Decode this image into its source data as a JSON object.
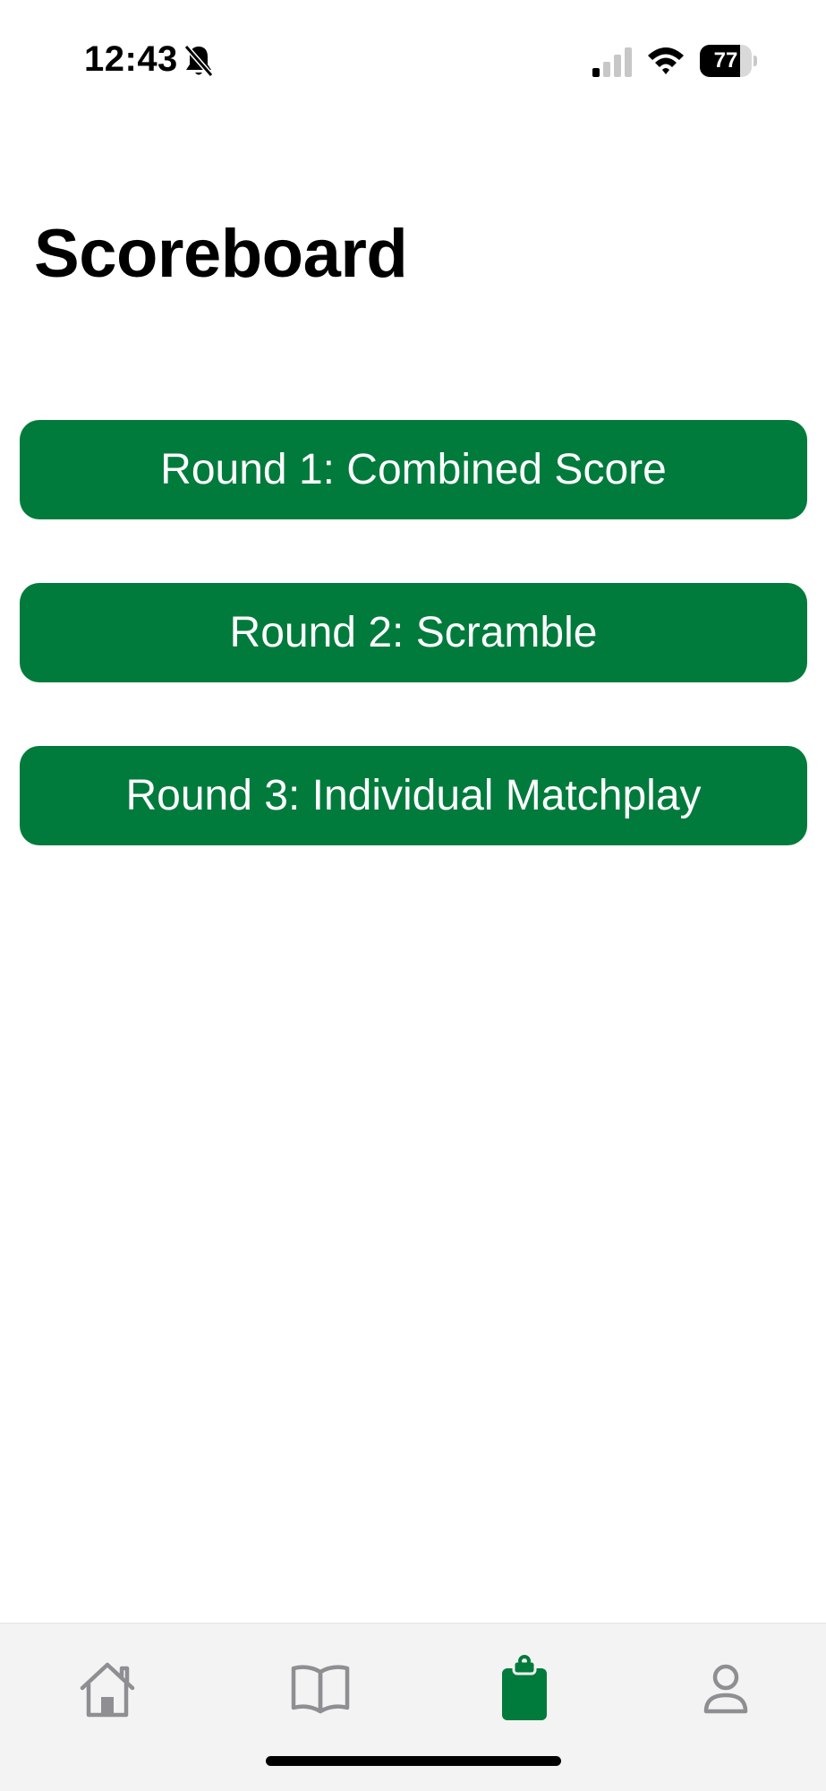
{
  "status_bar": {
    "time": "12:43",
    "battery_level": "77",
    "battery_fraction": 0.77,
    "signal_bars_active": 1,
    "signal_bars_total": 4,
    "icons": [
      "bell-slash-icon",
      "cellular-signal-icon",
      "wifi-icon",
      "battery-icon"
    ]
  },
  "header": {
    "title": "Scoreboard"
  },
  "rounds": [
    {
      "label": "Round 1: Combined Score"
    },
    {
      "label": "Round 2: Scramble"
    },
    {
      "label": "Round 3: Individual Matchplay"
    }
  ],
  "tab_bar": {
    "tabs": [
      {
        "icon": "home-icon",
        "active": false
      },
      {
        "icon": "book-icon",
        "active": false
      },
      {
        "icon": "clipboard-icon",
        "active": true
      },
      {
        "icon": "person-icon",
        "active": false
      }
    ]
  },
  "colors": {
    "accent": "#007b3c",
    "button_text": "#ffffff",
    "tab_inactive": "#8e8e93",
    "tab_bar_bg": "#f3f3f3"
  }
}
